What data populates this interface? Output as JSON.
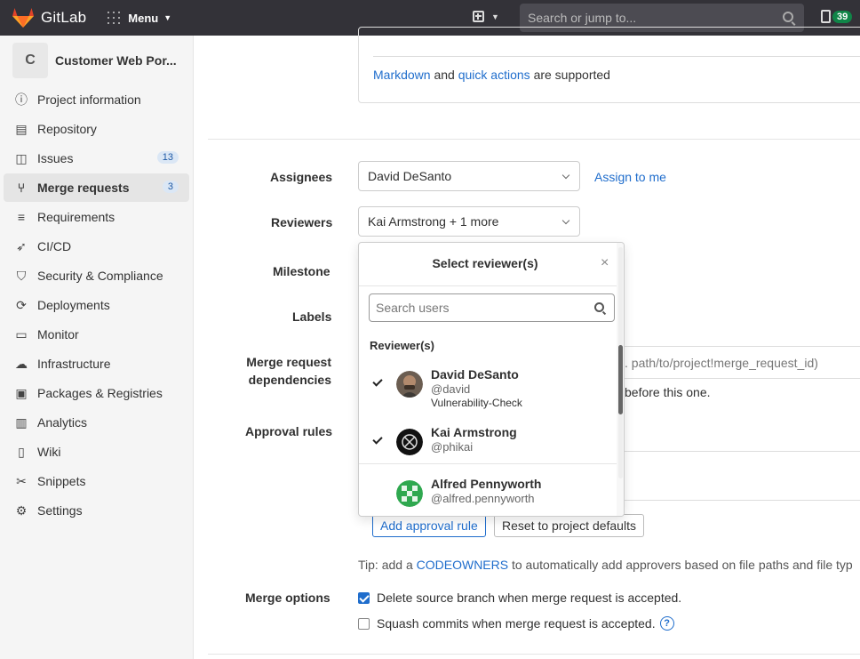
{
  "topbar": {
    "brand": "GitLab",
    "menu_label": "Menu",
    "search_placeholder": "Search or jump to...",
    "mr_count": "39"
  },
  "sidebar": {
    "project_initial": "C",
    "project_name": "Customer Web Por...",
    "items": [
      {
        "label": "Project information",
        "icon": "info-icon"
      },
      {
        "label": "Repository",
        "icon": "doc-icon"
      },
      {
        "label": "Issues",
        "icon": "issues-icon",
        "badge": "13"
      },
      {
        "label": "Merge requests",
        "icon": "merge-request-icon",
        "badge": "3",
        "active": true
      },
      {
        "label": "Requirements",
        "icon": "requirements-icon"
      },
      {
        "label": "CI/CD",
        "icon": "rocket-icon"
      },
      {
        "label": "Security & Compliance",
        "icon": "shield-icon"
      },
      {
        "label": "Deployments",
        "icon": "deployments-icon"
      },
      {
        "label": "Monitor",
        "icon": "monitor-icon"
      },
      {
        "label": "Infrastructure",
        "icon": "cloud-icon"
      },
      {
        "label": "Packages & Registries",
        "icon": "package-icon"
      },
      {
        "label": "Analytics",
        "icon": "chart-icon"
      },
      {
        "label": "Wiki",
        "icon": "book-icon"
      },
      {
        "label": "Snippets",
        "icon": "scissors-icon"
      },
      {
        "label": "Settings",
        "icon": "gear-icon"
      }
    ]
  },
  "form": {
    "markdown_link": "Markdown",
    "and_text": "and",
    "quick_actions_link": "quick actions",
    "supported_text": "are supported",
    "assignees_label": "Assignees",
    "assignees_value": "David DeSanto",
    "assign_to_me": "Assign to me",
    "reviewers_label": "Reviewers",
    "reviewers_value": "Kai Armstrong + 1 more",
    "milestone_label": "Milestone",
    "labels_label": "Labels",
    "mr_deps_label_1": "Merge request",
    "mr_deps_label_2": "dependencies",
    "mr_deps_placeholder": ". path/to/project!merge_request_id)",
    "mr_deps_help": "before this one.",
    "approval_rules_label": "Approval rules",
    "add_approval_rule": "Add approval rule",
    "reset_defaults": "Reset to project defaults",
    "tip_prefix": "Tip: add a",
    "codeowners_link": "CODEOWNERS",
    "tip_suffix": "to automatically add approvers based on file paths and file typ",
    "merge_options_label": "Merge options",
    "delete_source_branch": "Delete source branch when merge request is accepted.",
    "delete_source_checked": true,
    "squash_commits": "Squash commits when merge request is accepted.",
    "squash_checked": false,
    "help_glyph": "?"
  },
  "reviewer_popover": {
    "title": "Select reviewer(s)",
    "close_glyph": "×",
    "search_placeholder": "Search users",
    "section": "Reviewer(s)",
    "users": [
      {
        "name": "David DeSanto",
        "handle": "@david",
        "role": "Vulnerability-Check",
        "selected": true
      },
      {
        "name": "Kai Armstrong",
        "handle": "@phikai",
        "role": "",
        "selected": true
      },
      {
        "name": "Alfred Pennyworth",
        "handle": "@alfred.pennyworth",
        "role": "",
        "selected": false
      }
    ]
  },
  "colors": {
    "accent": "#1f6dcc",
    "topbar": "#333238",
    "badge_green": "#108548"
  }
}
